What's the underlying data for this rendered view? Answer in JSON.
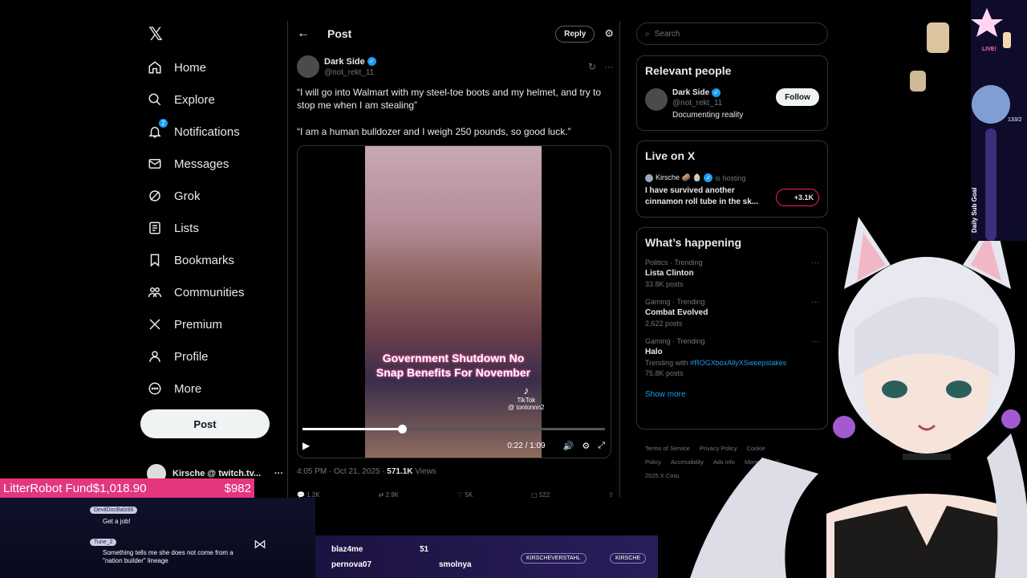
{
  "nav": {
    "items": [
      {
        "label": "Home",
        "icon": "home-icon"
      },
      {
        "label": "Explore",
        "icon": "search-icon"
      },
      {
        "label": "Notifications",
        "icon": "bell-icon",
        "badge": "2"
      },
      {
        "label": "Messages",
        "icon": "mail-icon"
      },
      {
        "label": "Grok",
        "icon": "grok-icon"
      },
      {
        "label": "Lists",
        "icon": "list-icon"
      },
      {
        "label": "Bookmarks",
        "icon": "bookmark-icon"
      },
      {
        "label": "Communities",
        "icon": "communities-icon"
      },
      {
        "label": "Premium",
        "icon": "x-icon"
      },
      {
        "label": "Profile",
        "icon": "person-icon"
      },
      {
        "label": "More",
        "icon": "more-circle-icon"
      }
    ],
    "post_button": "Post",
    "account_name": "Kirsche @ twitch.tv...",
    "account_more": "···"
  },
  "post": {
    "header_title": "Post",
    "reply_button": "Reply",
    "author_name": "Dark Side",
    "author_handle": "@not_rekt_11",
    "paragraph1": "“I will go into Walmart with my steel-toe boots and my helmet, and try to stop me when I am stealing”",
    "paragraph2": "“I am a human bulldozer and I weigh 250 pounds, so good luck.”",
    "video": {
      "caption_line1": "Government Shutdown No",
      "caption_line2": "Snap Benefits For November",
      "watermark": "TikTok",
      "watermark_handle": "@ tonlonnn2",
      "time": "0:22 / 1:09",
      "progress": 0.33
    },
    "timestamp": "4:05 PM · Oct 21, 2025 · ",
    "views_count": "571.1K",
    "views_label": " Views",
    "actions": [
      "1.2K",
      "2.9K",
      "5K",
      "522",
      ""
    ]
  },
  "search": {
    "placeholder": "Search"
  },
  "relevant_people": {
    "title": "Relevant people",
    "name": "Dark Side",
    "handle": "@not_rekt_11",
    "bio": "Documenting reality",
    "follow": "Follow"
  },
  "live": {
    "title": "Live on X",
    "host": "Kirsche 🥔 🧁",
    "hosting": "is hosting",
    "stream_title": "I have survived another cinnamon roll tube in the sk...",
    "count": "+3.1K"
  },
  "happening": {
    "title": "What’s happening",
    "trends": [
      {
        "cat": "Politics · Trending",
        "title": "Lista Clinton",
        "sub": "33.8K posts",
        "tag": ""
      },
      {
        "cat": "Gaming · Trending",
        "title": "Combat Evolved",
        "sub": "2,622 posts",
        "tag": ""
      },
      {
        "cat": "Gaming · Trending",
        "title": "Halo",
        "sub": "Trending with ",
        "tag": "#ROGXboxAllyXSweepstakes",
        "sub2": "75.8K posts"
      }
    ],
    "show_more": "Show more"
  },
  "footer": {
    "links": [
      "Terms of Service",
      "Privacy Policy",
      "Cookie Policy",
      "Accessibility",
      "Ads info",
      "More ···",
      "© 2025 X Corp."
    ]
  },
  "stream": {
    "fund_label": "LitterRobot Fund",
    "fund_amount": "$1,018.90",
    "fund_goal": "$982",
    "chat": [
      {
        "user": "DevilDocBalz86",
        "msg": "Get a job!"
      },
      {
        "user": "Tune_2",
        "msg": "Something tells me she does not come from a \"nation builder\" lineage"
      }
    ],
    "subs": [
      "blaz4me",
      "pernova07",
      "Ƽ1",
      "smolnya"
    ],
    "socials": [
      "KIRSCHEVERSTAHL",
      "KIRSCHE"
    ],
    "goal_label": "Daily Sub Goal",
    "live_tag": "LIVE!",
    "counter": "133/2"
  },
  "colors": {
    "accent": "#1d9bf0",
    "fund_bg": "#e4367f",
    "live_border": "#f91880"
  }
}
